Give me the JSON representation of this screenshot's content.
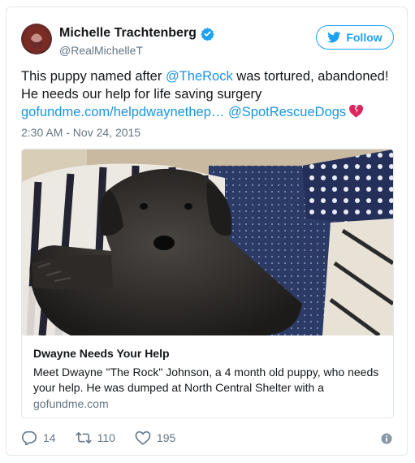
{
  "user": {
    "display_name": "Michelle Trachtenberg",
    "handle": "@RealMichelleT"
  },
  "follow_button": {
    "label": "Follow"
  },
  "tweet": {
    "text_1": "This puppy named after ",
    "mention_1": "@TheRock",
    "text_2": " was tortured, abandoned! He needs our help for life saving surgery",
    "link": "gofundme.com/helpdwaynethep…",
    "mention_2": "@SpotRescueDogs",
    "emoji": "broken-heart-icon",
    "timestamp": "2:30 AM - Nov 24, 2015"
  },
  "link_card": {
    "title": "Dwayne Needs Your Help",
    "description": "Meet Dwayne \"The Rock\" Johnson, a 4 month old puppy, who needs your help.  He was dumped at North Central Shelter with a",
    "domain": "gofundme.com"
  },
  "actions": {
    "replies": "14",
    "retweets": "110",
    "likes": "195"
  },
  "colors": {
    "accent": "#1da1f2",
    "link": "#1b95e0",
    "muted": "#657786",
    "border": "#e1e8ed",
    "broken_heart": "#e0245e"
  }
}
